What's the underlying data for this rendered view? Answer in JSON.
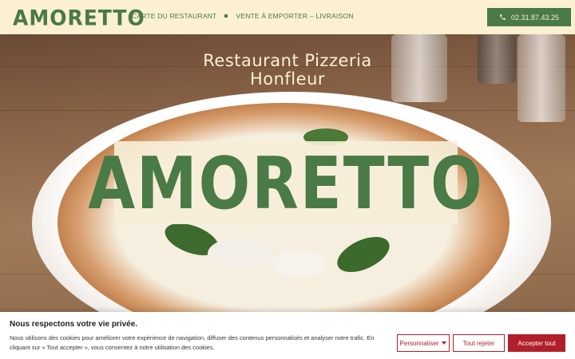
{
  "header": {
    "logo": "AMORETTO",
    "nav": [
      {
        "label": "CARTE DU RESTAURANT"
      },
      {
        "label": "VENTE À EMPORTER – LIVRAISON"
      }
    ],
    "phone": "02.31.87.43.25",
    "phone_icon": "phone-icon"
  },
  "hero": {
    "title_line1": "Restaurant Pizzeria",
    "title_line2": "Honfleur",
    "logo": "AMORETTO"
  },
  "cookie": {
    "title": "Nous respectons votre vie privée.",
    "text": "Nous utilisons des cookies pour améliorer votre expérience de navigation, diffuser des contenus personnalisés et analyser notre trafic. En cliquant sur « Tout accepter », vous consentez à notre utilisation des cookies.",
    "customize": "Personnaliser",
    "reject": "Tout rejeter",
    "accept": "Accepter tout"
  },
  "colors": {
    "brand_green": "#4a7a45",
    "cream": "#fbf0cf",
    "accent_red": "#b01f2a"
  }
}
